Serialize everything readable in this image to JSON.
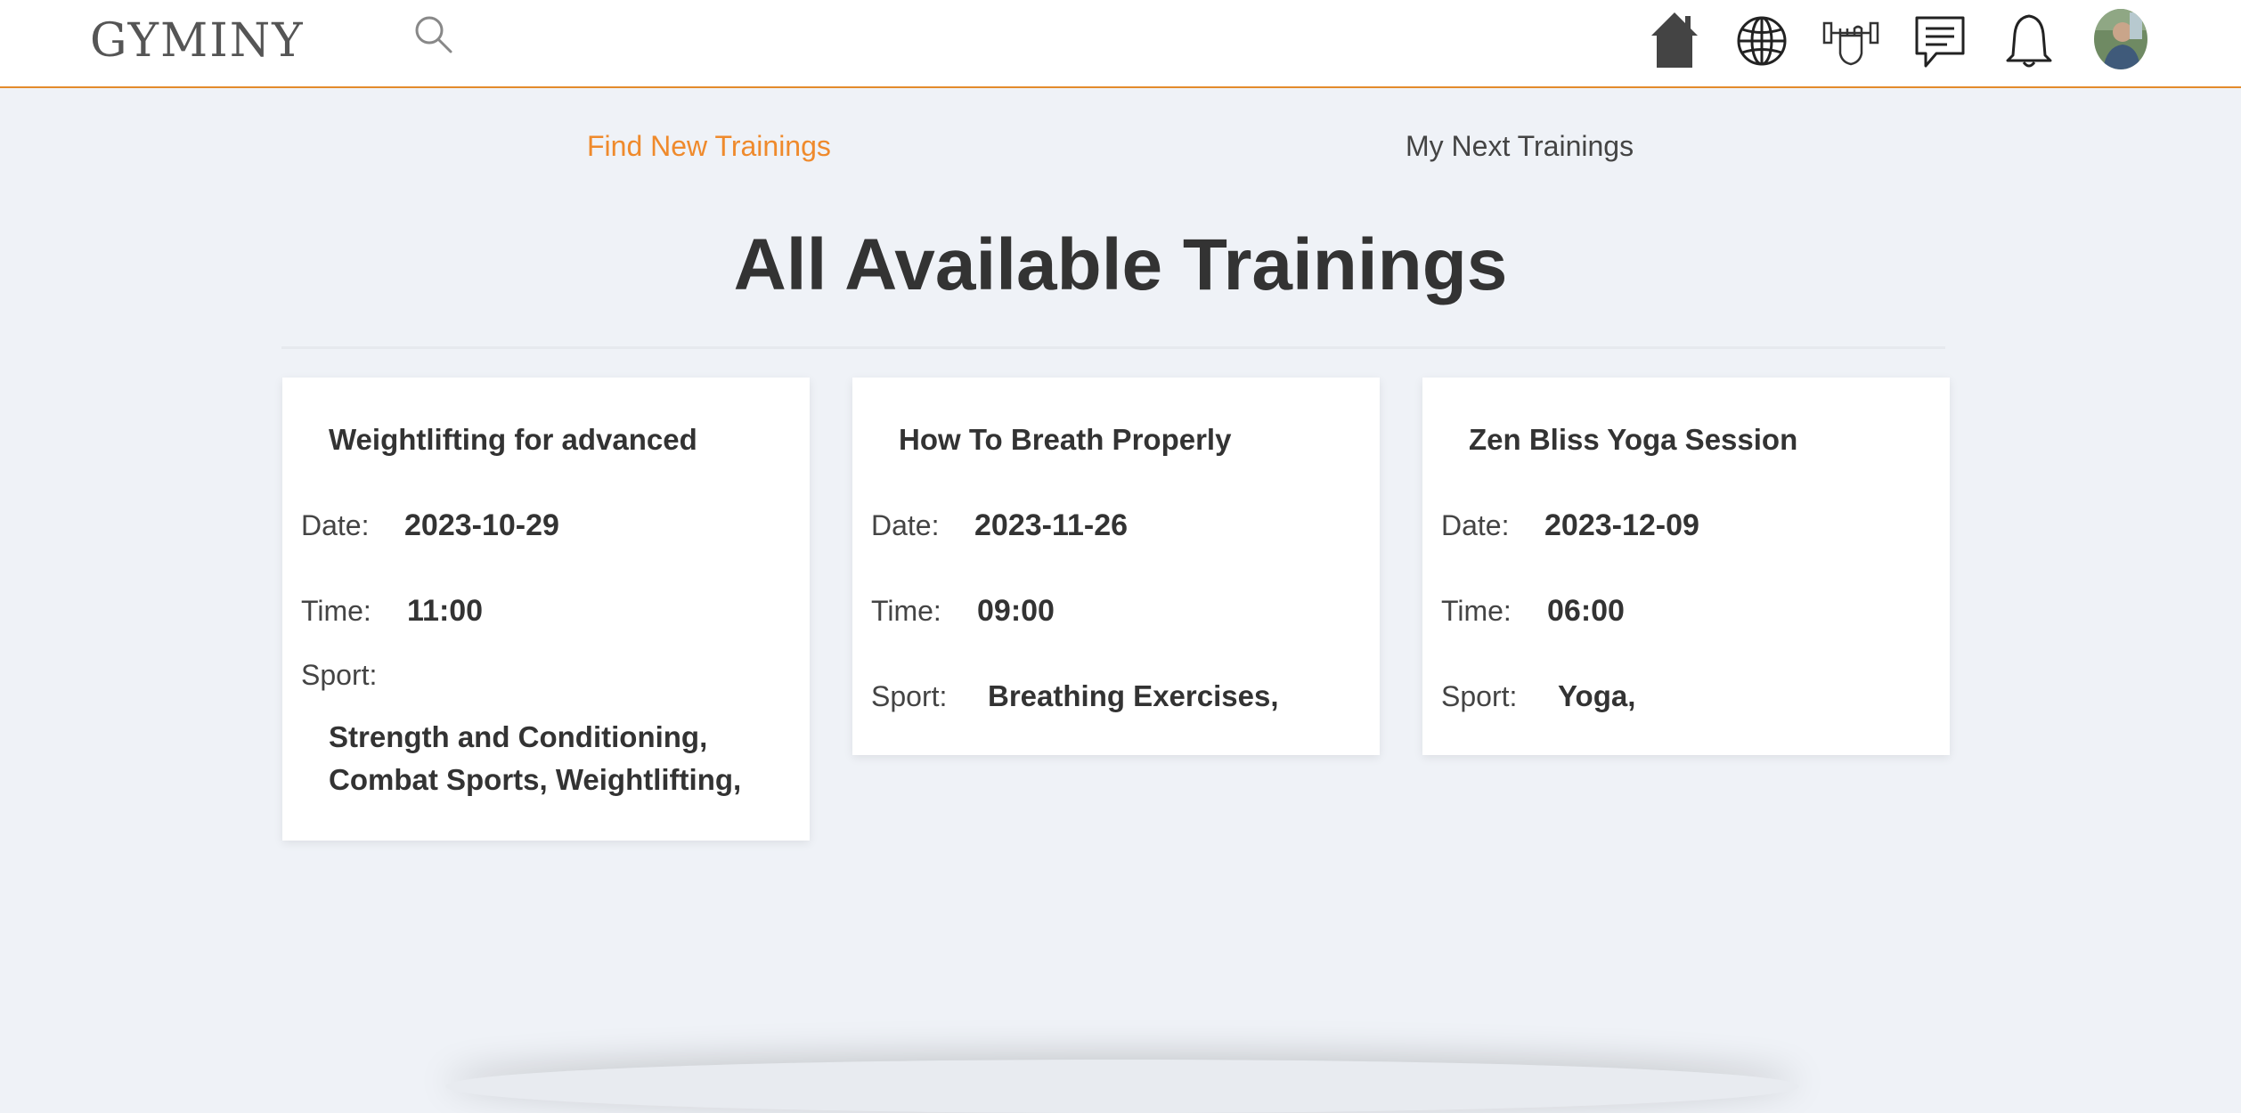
{
  "header": {
    "logo": "GYMINY",
    "icons": [
      "search-icon",
      "home-icon",
      "globe-icon",
      "dumbbell-fist-icon",
      "chat-icon",
      "bell-icon",
      "avatar"
    ]
  },
  "tabs": {
    "find": "Find New Trainings",
    "next": "My Next Trainings"
  },
  "main": {
    "title": "All Available Trainings",
    "labels": {
      "date": "Date:",
      "time": "Time:",
      "sport": "Sport:"
    },
    "trainings": [
      {
        "name": "Weightlifting for advanced",
        "date": "2023-10-29",
        "time": "11:00",
        "sport_line1": "Strength and Conditioning,",
        "sport_line2": "Combat Sports, Weightlifting,"
      },
      {
        "name": "How To Breath Properly",
        "date": "2023-11-26",
        "time": "09:00",
        "sport": "Breathing Exercises,"
      },
      {
        "name": "Zen Bliss Yoga Session",
        "date": "2023-12-09",
        "time": "06:00",
        "sport": "Yoga,"
      }
    ]
  },
  "colors": {
    "accent": "#ef8a2c",
    "header_border": "#e38b2c",
    "background": "#eff2f7",
    "text": "#333333"
  }
}
